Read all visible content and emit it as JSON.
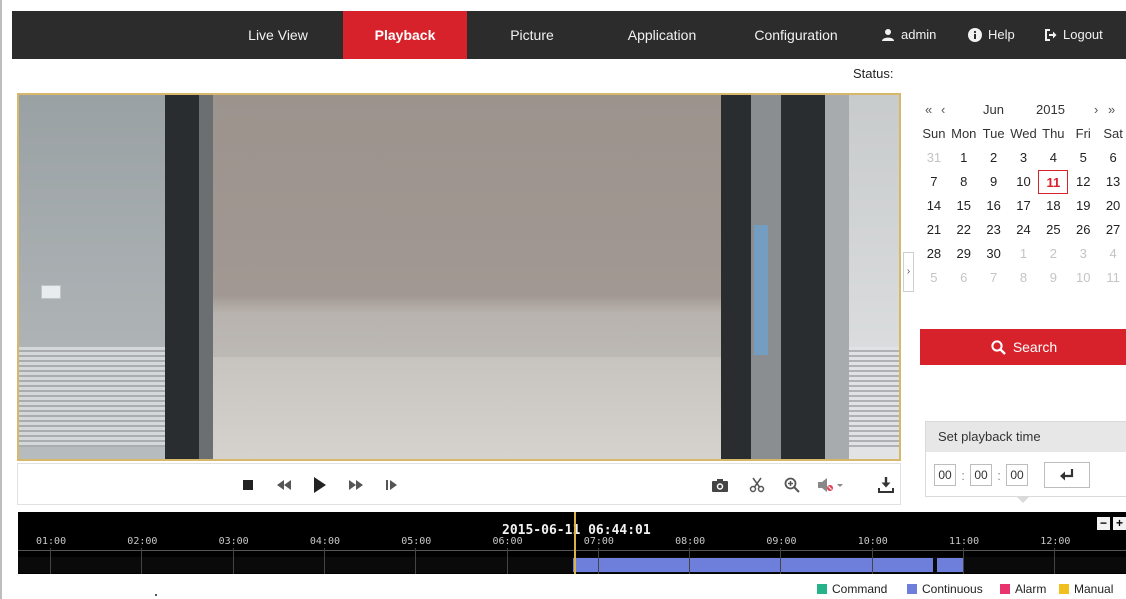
{
  "nav": {
    "items": [
      {
        "label": "Live View",
        "active": false
      },
      {
        "label": "Playback",
        "active": true
      },
      {
        "label": "Picture",
        "active": false
      },
      {
        "label": "Application",
        "active": false
      },
      {
        "label": "Configuration",
        "active": false
      }
    ],
    "user": {
      "label": "admin",
      "icon": "user-icon"
    },
    "help": {
      "label": "Help",
      "icon": "info-icon"
    },
    "logout": {
      "label": "Logout",
      "icon": "logout-icon"
    }
  },
  "status_label": "Status:",
  "controls": {
    "left": [
      "stop-icon",
      "slow-backward-icon",
      "play-icon",
      "fast-forward-icon",
      "single-frame-icon"
    ],
    "right": [
      "capture-icon",
      "clip-icon",
      "digital-zoom-icon",
      "audio-muted-icon",
      "download-icon"
    ]
  },
  "calendar": {
    "month": "Jun",
    "year": "2015",
    "weekdays": [
      "Sun",
      "Mon",
      "Tue",
      "Wed",
      "Thu",
      "Fri",
      "Sat"
    ],
    "weeks": [
      [
        "31",
        "1",
        "2",
        "3",
        "4",
        "5",
        "6"
      ],
      [
        "7",
        "8",
        "9",
        "10",
        "11",
        "12",
        "13"
      ],
      [
        "14",
        "15",
        "16",
        "17",
        "18",
        "19",
        "20"
      ],
      [
        "21",
        "22",
        "23",
        "24",
        "25",
        "26",
        "27"
      ],
      [
        "28",
        "29",
        "30",
        "1",
        "2",
        "3",
        "4"
      ],
      [
        "5",
        "6",
        "7",
        "8",
        "9",
        "10",
        "11"
      ]
    ],
    "selected_day": "11",
    "nav_prev_year": "«",
    "nav_prev_month": "‹",
    "nav_next_month": "›",
    "nav_next_year": "»"
  },
  "search": {
    "label": "Search",
    "icon": "search-icon"
  },
  "playback_time": {
    "title": "Set playback time",
    "hour": "00",
    "minute": "00",
    "second": "00",
    "go_icon": "enter-icon"
  },
  "timeline": {
    "current_time": "2015-06-11 06:44:01",
    "ticks": [
      "01:00",
      "02:00",
      "03:00",
      "04:00",
      "05:00",
      "06:00",
      "07:00",
      "08:00",
      "09:00",
      "10:00",
      "11:00",
      "12:00"
    ],
    "zoom_out": "−",
    "zoom_in": "+",
    "recordings": [
      {
        "type": "Continuous",
        "start": "06:44",
        "end": "10:40"
      },
      {
        "type": "Continuous",
        "start": "10:43",
        "end": "11:00"
      }
    ],
    "colors": {
      "Command": "#26b38a",
      "Continuous": "#6d7fdb",
      "Alarm": "#e8336d",
      "Manual": "#f2c01e"
    }
  },
  "legend": [
    {
      "label": "Command",
      "color": "#26b38a"
    },
    {
      "label": "Continuous",
      "color": "#6d7fdb"
    },
    {
      "label": "Alarm",
      "color": "#e8336d"
    },
    {
      "label": "Manual",
      "color": "#f2c01e"
    }
  ],
  "colors": {
    "nav_bg": "#2c2c2c",
    "accent": "#d8222b",
    "video_border": "#d7b86a"
  }
}
